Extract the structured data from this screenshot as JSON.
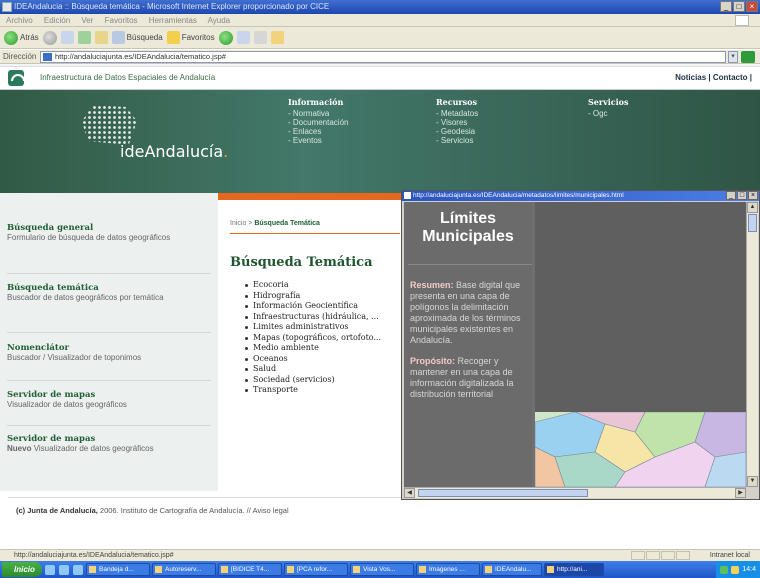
{
  "browser": {
    "title": "IDEAndalucia :: Búsqueda temática - Microsoft Internet Explorer proporcionado por CICE",
    "menu": [
      "Archivo",
      "Edición",
      "Ver",
      "Favoritos",
      "Herramientas",
      "Ayuda"
    ],
    "toolbar": {
      "back": "Atrás",
      "search": "Búsqueda",
      "favorites": "Favoritos"
    },
    "address_label": "Dirección",
    "address": "http://andaluciajunta.es/IDEAndalucia/tematico.jsp#",
    "status_url": "http://andaluciajunta.es/IDEAndalucia/tematico.jsp#",
    "status_zone": "Intranet local"
  },
  "site": {
    "top_title": "Infraestructura de Datos Espaciales de Andalucía",
    "top_links": "Noticias | Contacto |",
    "logo_text": "ideAndalucía",
    "logo_dot": ".",
    "nav": [
      {
        "heading": "Información",
        "items": [
          "- Normativa",
          "- Documentación",
          "- Enlaces",
          "- Eventos"
        ]
      },
      {
        "heading": "Recursos",
        "items": [
          "- Metadatos",
          "- Visores",
          "- Geodesia",
          "- Servicios"
        ]
      },
      {
        "heading": "Servicios",
        "items": [
          "- Ogc"
        ]
      }
    ]
  },
  "sidebar": [
    {
      "title": "Búsqueda general",
      "desc": "Formulario de búsqueda de datos geográficos"
    },
    {
      "title": "Búsqueda temática",
      "desc": "Buscador de datos geográficos por temática"
    },
    {
      "title": "Nomenclátor",
      "desc": "Buscador / Visualizador de toponimos"
    },
    {
      "title": "Servidor de mapas",
      "desc": "Visualizador de datos geográficos"
    },
    {
      "title": "Servidor de mapas",
      "desc_new": "Nuevo",
      "desc": "Visualizador de datos geográficos"
    }
  ],
  "content": {
    "breadcrumb_home": "Inicio",
    "breadcrumb_sep": " > ",
    "breadcrumb_current": "Búsqueda Temática",
    "heading": "Búsqueda Temática",
    "topics": [
      "Ecocoria",
      "Hidrografía",
      "Información Geocientífica",
      "Infraestructuras (hidráulica, ...",
      "Limites administrativos",
      "Mapas (topográficos, ortofoto...",
      "Medio ambiente",
      "Oceanos",
      "Salud",
      "Sociedad (servicios)",
      "Transporte"
    ]
  },
  "footer": {
    "org": "(c) Junta de Andalucía,",
    "rest": " 2006. Instituto de Cartografía de Andalucía. // Aviso legal"
  },
  "popup": {
    "title": "http://andaluciajunta.es/IDEAndalucia/metadatos/limites/municipales.html",
    "heading": "Límites Municipales",
    "resumen_label": "Resumen:",
    "resumen": "Base digital que presenta en una capa de polígonos la delimitación aproximada de los términos municipales existentes en Andalucía.",
    "proposito_label": "Propósito:",
    "proposito": "Recoger y mantener en una capa de información digitalizada la distribución territorial"
  },
  "taskbar": {
    "start": "Inicio",
    "tasks": [
      "Bandeja d...",
      "Autoreserv...",
      "[BIDICE T4...",
      "[PCA refor...",
      "Vista Vos...",
      "Imagenes ...",
      "IDEAndalu...",
      "http://ani..."
    ],
    "clock": "14:4"
  },
  "colors": {
    "accent_orange": "#e8671e",
    "header_green": "#3b6b58",
    "title_green": "#1d5630"
  }
}
